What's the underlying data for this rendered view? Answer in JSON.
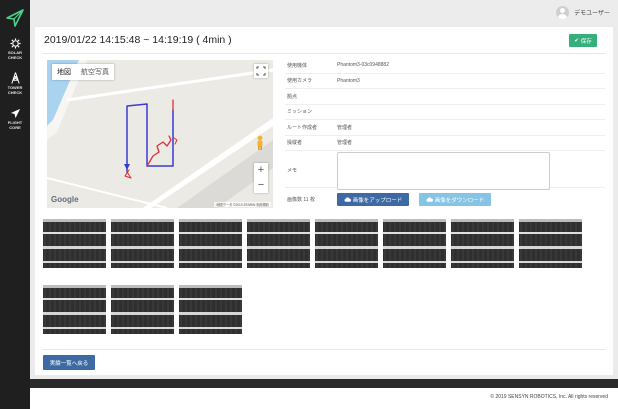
{
  "sidebar": {
    "items": [
      {
        "label": "SOLAR\nCHECK",
        "icon": "sun-gear-icon"
      },
      {
        "label": "TOWER\nCHECK",
        "icon": "tower-icon"
      },
      {
        "label": "FLIGHT\nCORE",
        "icon": "airplane-icon"
      }
    ]
  },
  "header": {
    "user_name": "デモユーザー"
  },
  "page": {
    "title": "2019/01/22 14:15:48 ~ 14:19:19 ( 4min )",
    "save_label": "保存"
  },
  "map": {
    "tab_map": "地図",
    "tab_aerial": "航空写真",
    "zoom_in": "+",
    "zoom_out": "−",
    "logo": "Google",
    "attribution": "地図データ ©2019 ZENRIN  利用規約"
  },
  "info": {
    "rows": [
      {
        "key": "使用機体",
        "value": "Phantom3-03c0948882"
      },
      {
        "key": "使用カメラ",
        "value": "Phantom3"
      },
      {
        "key": "拠点",
        "value": ""
      },
      {
        "key": "ミッション",
        "value": ""
      },
      {
        "key": "ルート作成者",
        "value": "管理者"
      },
      {
        "key": "操縦者",
        "value": "管理者"
      }
    ],
    "memo_label": "メモ",
    "memo_value": "",
    "count_label": "画像数 11 枚",
    "upload_label": "画像をアップロード",
    "download_label": "画像をダウンロード"
  },
  "images": {
    "count": 11
  },
  "back_label": "実績一覧へ戻る",
  "footer": {
    "copyright": "© 2019 SENSYN ROBOTICS, Inc. All rights reserved"
  },
  "colors": {
    "sidebar": "#1f1f1f",
    "save": "#35b07d",
    "primary": "#3e6aa3",
    "secondary": "#86c4e6",
    "flight_path": "#3a3ad0",
    "flight_path_alt": "#e0303a"
  }
}
